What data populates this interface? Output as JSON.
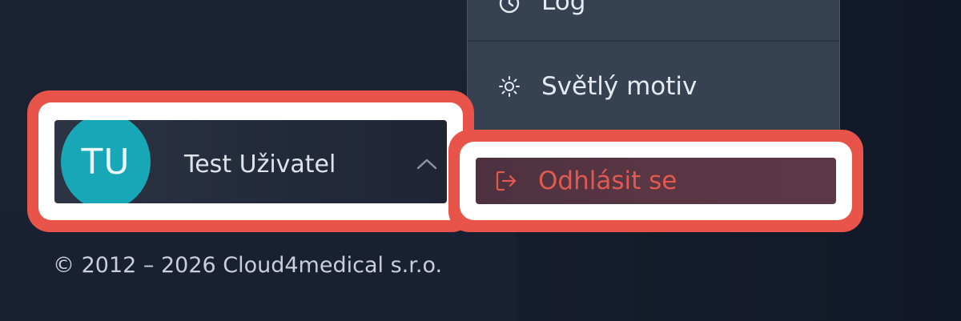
{
  "menu": {
    "items": [
      {
        "label": "Log",
        "icon": "clock-icon"
      },
      {
        "label": "Světlý motiv",
        "icon": "sun-icon"
      }
    ],
    "logout": {
      "label": "Odhlásit se",
      "icon": "logout-icon",
      "color": "#e05a50"
    }
  },
  "user": {
    "initials": "TU",
    "name": "Test Uživatel",
    "avatar_color": "#17a7b6",
    "toggle_icon": "chevron-up-icon"
  },
  "footer": {
    "copyright": "© 2012 – 2026 Cloud4medical s.r.o."
  },
  "colors": {
    "highlight": "#e8544a",
    "menu_bg": "#364152",
    "page_bg": "#131a2a"
  }
}
